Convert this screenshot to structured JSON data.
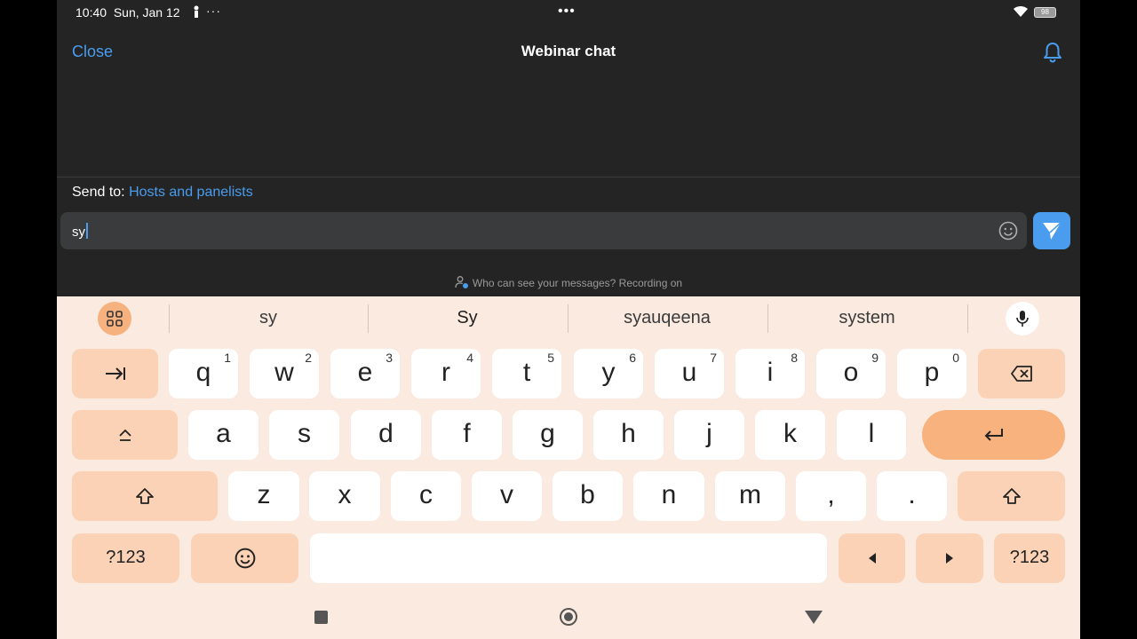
{
  "status_bar": {
    "time": "10:40",
    "date": "Sun, Jan 12",
    "more": "···",
    "center": "•••",
    "battery": "98"
  },
  "header": {
    "close_label": "Close",
    "title": "Webinar chat"
  },
  "send_to": {
    "label": "Send to:",
    "target": "Hosts and panelists"
  },
  "input": {
    "value": "sy"
  },
  "privacy_note": "Who can see your messages? Recording on",
  "keyboard": {
    "suggestions": [
      "sy",
      "Sy",
      "syauqeena",
      "system"
    ],
    "row1": [
      {
        "key": "q",
        "hint": "1"
      },
      {
        "key": "w",
        "hint": "2"
      },
      {
        "key": "e",
        "hint": "3"
      },
      {
        "key": "r",
        "hint": "4"
      },
      {
        "key": "t",
        "hint": "5"
      },
      {
        "key": "y",
        "hint": "6"
      },
      {
        "key": "u",
        "hint": "7"
      },
      {
        "key": "i",
        "hint": "8"
      },
      {
        "key": "o",
        "hint": "9"
      },
      {
        "key": "p",
        "hint": "0"
      }
    ],
    "row2": [
      "a",
      "s",
      "d",
      "f",
      "g",
      "h",
      "j",
      "k",
      "l"
    ],
    "row3": [
      "z",
      "x",
      "c",
      "v",
      "b",
      "n",
      "m",
      ",",
      "."
    ],
    "symbols_label": "?123"
  },
  "colors": {
    "accent": "#4a9dee",
    "background": "#242424",
    "keyboard_bg": "#fbeae0",
    "modifier_key": "#fbd2b5",
    "enter_key": "#f7b27e"
  }
}
